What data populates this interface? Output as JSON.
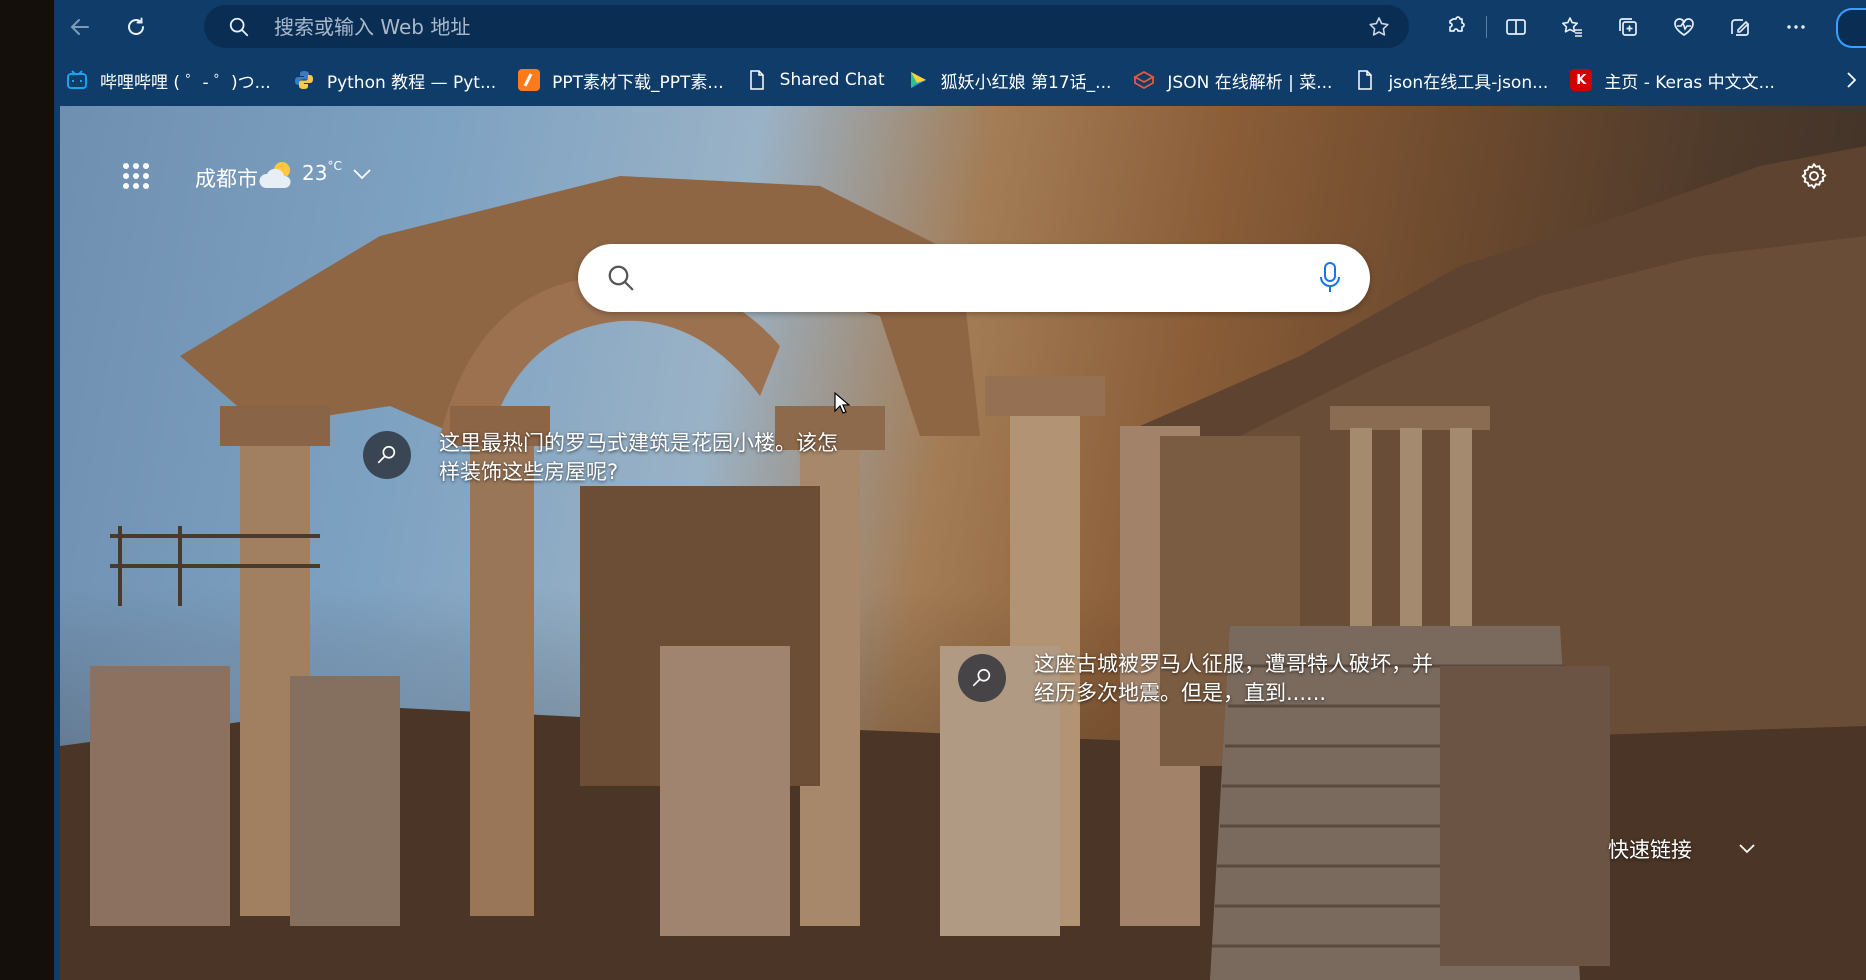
{
  "toolbar": {
    "back_icon": "arrow-left-icon",
    "refresh_icon": "refresh-icon",
    "address_placeholder": "搜索或输入 Web 地址",
    "right_icons": [
      "extensions-icon",
      "split-screen-icon",
      "favorites-icon",
      "collections-icon",
      "browser-essentials-icon",
      "copilot-icon",
      "more-icon"
    ]
  },
  "bookmarks": {
    "items": [
      {
        "label": "哔哩哔哩 ( ゜- ゜)つ...",
        "icon": "bilibili-icon",
        "color": "#20a0e8"
      },
      {
        "label": "Python 教程 — Pyt...",
        "icon": "python-icon",
        "color": "#f7c948"
      },
      {
        "label": "PPT素材下载_PPT素...",
        "icon": "ppt-icon",
        "color": "#ff7a1a"
      },
      {
        "label": "Shared Chat",
        "icon": "page-icon",
        "color": "#ffffff"
      },
      {
        "label": "狐妖小红娘 第17话_...",
        "icon": "play-icon",
        "color": "#29c38d"
      },
      {
        "label": "JSON 在线解析 | 菜...",
        "icon": "cube-icon",
        "color": "#e8583a"
      },
      {
        "label": "json在线工具-json...",
        "icon": "page-icon",
        "color": "#ffffff"
      },
      {
        "label": "主页 - Keras 中文文...",
        "icon": "keras-icon",
        "color": "#d00000",
        "glyph": "K"
      }
    ]
  },
  "newtab": {
    "city": "成都市",
    "temperature": "23",
    "temp_unit": "°C",
    "search_placeholder": "",
    "hotspots": [
      {
        "text": "这里最热门的罗马式建筑是花园小楼。该怎样装饰这些房屋呢?"
      },
      {
        "text": "这座古城被罗马人征服，遭哥特人破坏，并经历多次地震。但是，直到......"
      }
    ],
    "quick_links_label": "快速链接"
  }
}
